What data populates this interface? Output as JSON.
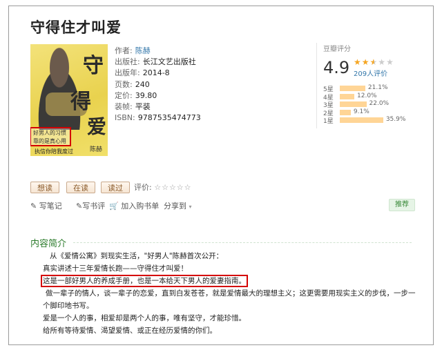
{
  "book": {
    "title": "守得住才叫爱",
    "cover_text": {
      "big1": "守",
      "big2": "得",
      "big3": "爱",
      "author": "陈赫",
      "tag_line1": "好男人的习惯",
      "tag_line2": "靠的是真心用",
      "bottom": "执信你陪我度过"
    }
  },
  "info": {
    "author_label": "作者:",
    "author": "陈赫",
    "publisher_label": "出版社:",
    "publisher": "长江文艺出版社",
    "year_label": "出版年:",
    "year": "2014-8",
    "pages_label": "页数:",
    "pages": "240",
    "price_label": "定价:",
    "price": "39.80",
    "binding_label": "装帧:",
    "binding": "平装",
    "isbn_label": "ISBN:",
    "isbn": "9787535474773"
  },
  "rating": {
    "label": "豆瓣评分",
    "score": "4.9",
    "stars_filled": 2.5,
    "count": "209人评价",
    "distribution": [
      {
        "star": "5星",
        "percent": 21.1,
        "text": "21.1%"
      },
      {
        "star": "4星",
        "percent": 12.0,
        "text": "12.0%"
      },
      {
        "star": "3星",
        "percent": 22.0,
        "text": "22.0%"
      },
      {
        "star": "2星",
        "percent": 9.1,
        "text": "9.1%"
      },
      {
        "star": "1星",
        "percent": 35.9,
        "text": "35.9%"
      }
    ],
    "bar_color": "#ffd596"
  },
  "buttons": {
    "want_read": "想读",
    "reading": "在读",
    "read": "读过",
    "evaluate_label": "评价:",
    "evaluate_stars": "☆☆☆☆☆"
  },
  "actions": {
    "write_note": "写笔记",
    "write_review": "写书评",
    "add_cart": "加入购书单",
    "share": "分享到",
    "recommend": "推荐"
  },
  "intro": {
    "title": "内容简介",
    "lines": [
      "从《爱情公寓》到现实生活，\"好男人\"陈赫首次公开：",
      "真实讲述十三年爱情长跑——守得住才叫爱！",
      "这是一部好男人的养成手册，也是一本给天下男人的爱妻指南。",
      "做一辈子的情人，谈一辈子的恋爱，直到白发苍苍，就是爱情最大的理想主义；这更需要用现实主义的步伐，一步一个脚印地书写。",
      "爱是一个人的事，相爱却是两个人的事，唯有坚守，才能珍惜。",
      "给所有等待爱情、渴望爱情、或正在经历爱情的你们。"
    ]
  },
  "colors": {
    "link": "#3377aa",
    "section_green": "#2a7a2a",
    "highlight_red": "#d40000",
    "star": "#f5a623"
  }
}
